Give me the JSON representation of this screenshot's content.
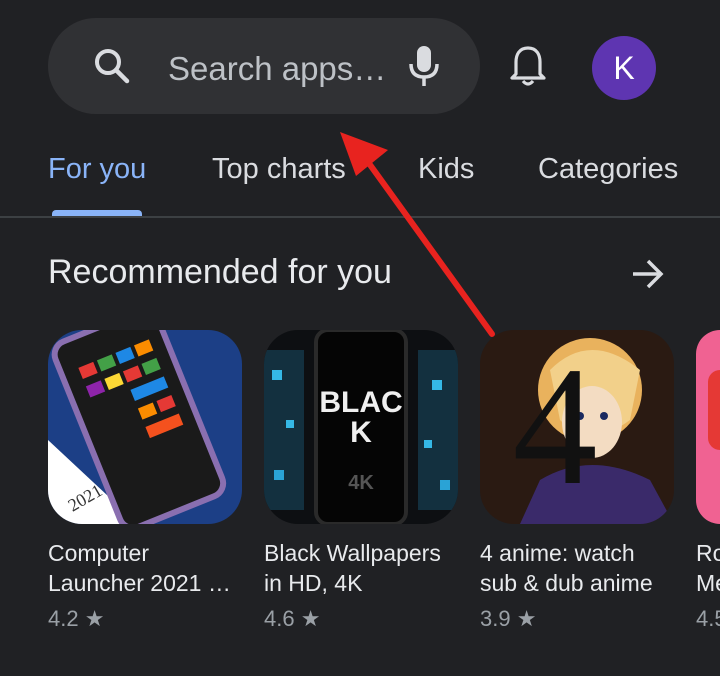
{
  "search": {
    "placeholder": "Search apps…"
  },
  "account": {
    "initial": "K",
    "color": "#5e35b1"
  },
  "tabs": [
    {
      "label": "For you",
      "active": true
    },
    {
      "label": "Top charts",
      "active": false
    },
    {
      "label": "Kids",
      "active": false
    },
    {
      "label": "Categories",
      "active": false
    }
  ],
  "section": {
    "title": "Recommended for you"
  },
  "apps": [
    {
      "name": "Computer\nLauncher 2021 …",
      "rating": "4.2 ★",
      "icon_text": "2021"
    },
    {
      "name": "Black Wallpapers\nin HD, 4K",
      "rating": "4.6 ★",
      "icon_text": "BLACK",
      "icon_subtext": "4K"
    },
    {
      "name": "4 anime: watch\nsub & dub anime",
      "rating": "3.9 ★",
      "icon_text": "4"
    },
    {
      "name": "Ro\nMe",
      "rating": "4.5"
    }
  ],
  "colors": {
    "accent": "#8ab4f8",
    "background": "#202124",
    "annotation_arrow": "#e8231f"
  },
  "icons": [
    "search-icon",
    "mic-icon",
    "bell-icon",
    "arrow-right-icon",
    "star-icon"
  ]
}
